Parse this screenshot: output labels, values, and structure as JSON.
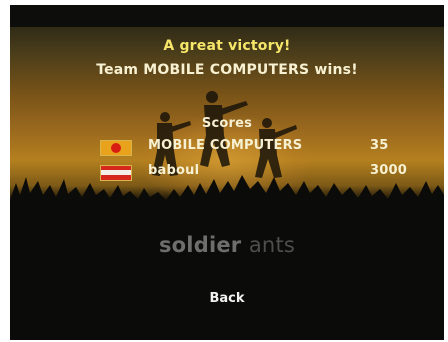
{
  "result": {
    "title": "A great victory!",
    "winner_line": "Team MOBILE  COMPUTERS wins!"
  },
  "scores": {
    "heading": "Scores",
    "teams": [
      {
        "name": "MOBILE  COMPUTERS",
        "score": "35",
        "flag_icon": "flag-red-star-icon"
      },
      {
        "name": "baboul",
        "score": "3000",
        "flag_icon": "flag-red-white-stripe-icon"
      }
    ]
  },
  "logo": {
    "word_1": "soldier",
    "word_2": "ants"
  },
  "menu": {
    "back_label": "Back"
  },
  "colors": {
    "title_yellow": "#f6e76a",
    "text_light": "#f7f1d2",
    "sky_orange": "#9c6a1e",
    "background": "#0b0b09"
  }
}
